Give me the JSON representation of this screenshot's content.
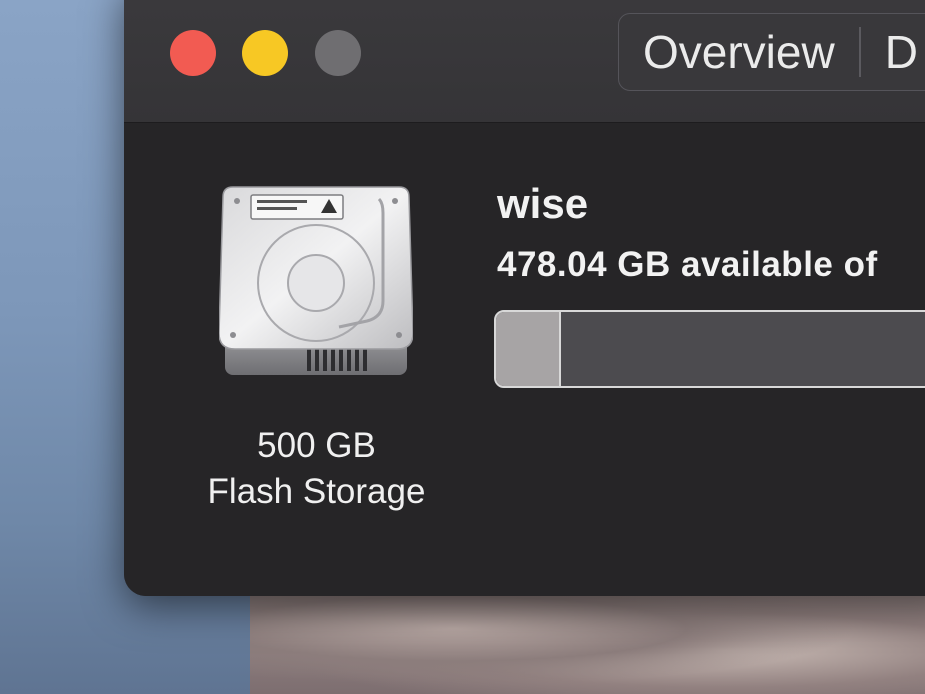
{
  "toolbar": {
    "tabs": [
      {
        "label": "Overview"
      },
      {
        "label": "D"
      }
    ]
  },
  "drive": {
    "icon": "hard-drive-icon",
    "capacity": "500 GB",
    "type": "Flash Storage"
  },
  "volume": {
    "name": "wise",
    "available_text": "478.04 GB available of",
    "used_fraction": 0.044
  },
  "colors": {
    "close": "#f25b52",
    "minimize": "#f7c824",
    "zoom_inactive": "#6f6e71",
    "bar_used": "#a7a4a5",
    "bar_free": "#4c4b4f"
  }
}
